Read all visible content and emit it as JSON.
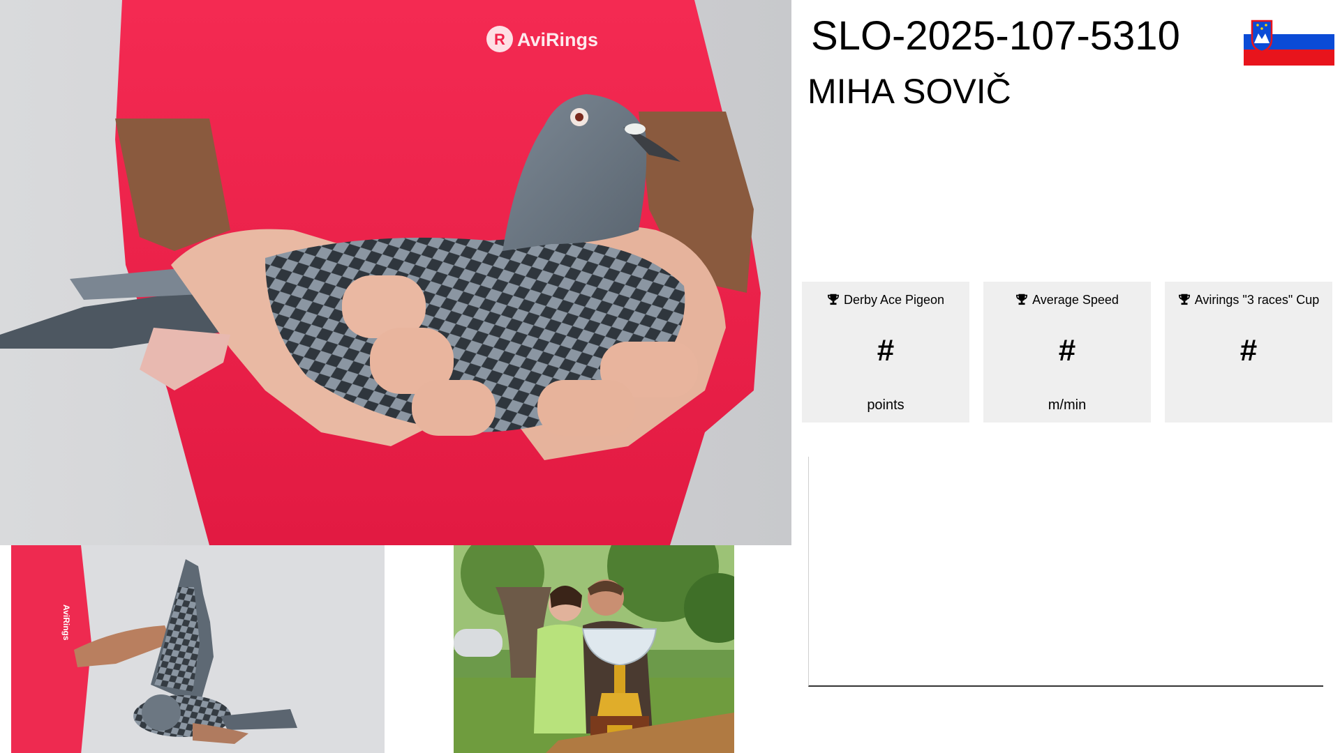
{
  "header": {
    "ring_number": "SLO-2025-107-5310",
    "owner_name": "MIHA SOVIČ",
    "flag_country": "Slovenia",
    "flag_colors": [
      "#ffffff",
      "#0b4bd6",
      "#e8141c"
    ]
  },
  "photos": {
    "main_shirt_logo": "AviRings",
    "wing_shirt_logo": "AviRings",
    "shirt_color": "#f0224a"
  },
  "stats": [
    {
      "title": "Derby Ace Pigeon",
      "value": "#",
      "unit": "points",
      "icon": "trophy-icon"
    },
    {
      "title": "Average Speed",
      "value": "#",
      "unit": "m/min",
      "icon": "trophy-icon"
    },
    {
      "title": "Avirings \"3 races\" Cup",
      "value": "#",
      "unit": "",
      "icon": "trophy-icon"
    }
  ],
  "colors": {
    "card_background": "#efefef",
    "text": "#000000"
  }
}
